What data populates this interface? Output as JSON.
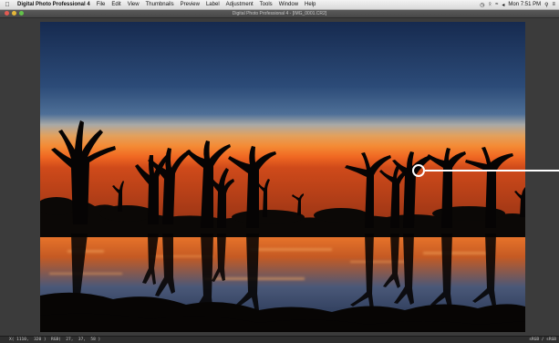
{
  "menubar": {
    "items": [
      "Digital Photo Professional 4",
      "File",
      "Edit",
      "View",
      "Thumbnails",
      "Preview",
      "Label",
      "Adjustment",
      "Tools",
      "Window",
      "Help"
    ],
    "clock": "Mon 7:51 PM"
  },
  "window": {
    "title": "Digital Photo Professional 4 - [IMG_0001.CR2]"
  },
  "statusbar": {
    "coordinates": "X( 1110,  320 )  RGB(  27,  37,  58 )",
    "color_space": "sRGB / sRGB"
  },
  "colors": {
    "viewer_background": "#3b3b3b",
    "traffic_close": "#e25b52",
    "traffic_minimize": "#e5b73a",
    "traffic_zoom": "#63c14a"
  }
}
